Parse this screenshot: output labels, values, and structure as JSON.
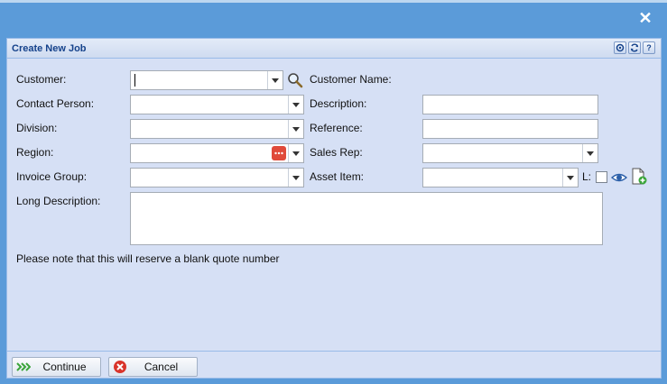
{
  "window": {
    "close_glyph": "✕"
  },
  "panel": {
    "title": "Create New Job",
    "tools": [
      "settings-icon",
      "refresh-icon",
      "help-icon"
    ]
  },
  "form": {
    "customer_label": "Customer:",
    "customer_value": "",
    "customer_name_label": "Customer Name:",
    "customer_name_value": "",
    "contact_label": "Contact Person:",
    "contact_value": "",
    "description_label": "Description:",
    "description_value": "",
    "division_label": "Division:",
    "division_value": "",
    "reference_label": "Reference:",
    "reference_value": "",
    "region_label": "Region:",
    "region_value": "",
    "sales_rep_label": "Sales Rep:",
    "sales_rep_value": "",
    "invoice_group_label": "Invoice Group:",
    "invoice_group_value": "",
    "asset_item_label": "Asset Item:",
    "asset_item_value": "",
    "l_label": "L:",
    "long_description_label": "Long Description:",
    "long_description_value": ""
  },
  "note": "Please note that this will reserve a blank quote number",
  "footer": {
    "continue_label": "Continue",
    "cancel_label": "Cancel"
  },
  "colors": {
    "window_bg": "#5b9bd9",
    "panel_bg": "#d6e0f5",
    "title_color": "#15428b",
    "continue_arrow": "#3aa53a",
    "cancel_red": "#d9342b",
    "region_btn": "#e04a3a"
  }
}
